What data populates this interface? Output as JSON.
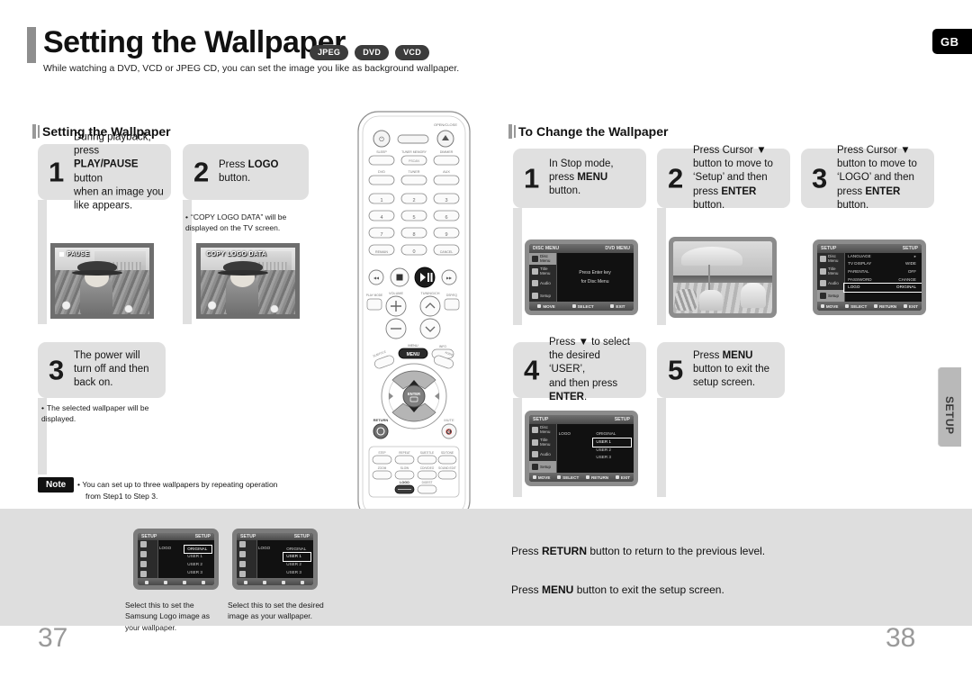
{
  "page": {
    "title": "Setting the Wallpaper",
    "subtitle": "While watching a DVD, VCD or JPEG CD, you can set the image you like as background wallpaper.",
    "badges": [
      "JPEG",
      "DVD",
      "VCD"
    ],
    "region_tab": "GB",
    "side_tab": "SETUP",
    "page_number_left": "37",
    "page_number_right": "38"
  },
  "left_section": {
    "heading": "Setting the Wallpaper",
    "steps": [
      {
        "number": "1",
        "line1": "During playback, press",
        "line2_bold": "PLAY/PAUSE",
        "line2_rest": " button",
        "line3": "when an image you",
        "line4": "like appears."
      },
      {
        "number": "2",
        "line1_pre": "Press ",
        "line1_bold": "LOGO",
        "line2": "button."
      },
      {
        "number": "3",
        "line1": "The power will",
        "line2": "turn off and then",
        "line3": "back on."
      }
    ],
    "note_under_step2": "“COPY LOGO DATA” will be displayed on the TV screen.",
    "note_under_step3": "The selected wallpaper will be displayed.",
    "photo1_osd": "PAUSE",
    "photo2_osd": "COPY LOGO DATA",
    "note_label": "Note",
    "note_body_line1": "You can set up to three wallpapers by repeating operation",
    "note_body_line2": "from Step1 to Step 3."
  },
  "right_section": {
    "heading": "To Change the Wallpaper",
    "steps": [
      {
        "number": "1",
        "line1": "In Stop mode,",
        "line2_pre": "press ",
        "line2_bold": "MENU",
        "line3": "button."
      },
      {
        "number": "2",
        "line1": "Press Cursor ▼",
        "line2": "button to move to",
        "line3": "‘Setup’ and then",
        "line4_pre": "press ",
        "line4_bold": "ENTER",
        "line4_post": " button."
      },
      {
        "number": "3",
        "line1": "Press Cursor ▼",
        "line2": "button to move to",
        "line3": "‘LOGO’ and then",
        "line4_pre": "press ",
        "line4_bold": "ENTER",
        "line4_post": " button."
      },
      {
        "number": "4",
        "line1": "Press ▼ to select",
        "line2": "the desired ‘USER’,",
        "line3": "and then press",
        "line4_bold": "ENTER",
        "line4_post": "."
      },
      {
        "number": "5",
        "line1_pre": "Press ",
        "line1_bold": "MENU",
        "line2": "button to exit the",
        "line3": "setup screen."
      }
    ]
  },
  "osd_screens": {
    "screen1": {
      "title_left": "DISC MENU",
      "title_right": "DVD MENU",
      "sidebar": [
        "Disc Menu",
        "Title Menu",
        "Audio",
        "Setup"
      ],
      "center_line1": "Press Enter key",
      "center_line2": "for Disc Menu",
      "footer": [
        "MOVE",
        "SELECT",
        "EXIT"
      ]
    },
    "screen2": {
      "title_left": "SETUP",
      "title_right": "SETUP",
      "sidebar": [
        "Disc Menu",
        "Title Menu",
        "Audio",
        "Setup"
      ],
      "rows": [
        {
          "label": "LANGUAGE",
          "value": ""
        },
        {
          "label": "TV DISPLAY",
          "value": "WIDE"
        },
        {
          "label": "PARENTAL",
          "value": "OFF"
        },
        {
          "label": "PASSWORD",
          "value": "CHANGE"
        },
        {
          "label": "LOGO",
          "value": "ORIGINAL",
          "highlighted": true
        }
      ],
      "footer": [
        "MOVE",
        "SELECT",
        "RETURN",
        "EXIT"
      ]
    },
    "screen3": {
      "title_left": "SETUP",
      "title_right": "SETUP",
      "sidebar": [
        "Disc Menu",
        "Title Menu",
        "Audio",
        "Setup"
      ],
      "field_label": "LOGO",
      "options": [
        "ORIGINAL",
        "USER 1",
        "USER 2",
        "USER 3"
      ],
      "selected_option": "USER 1",
      "footer": [
        "MOVE",
        "SELECT",
        "RETURN",
        "EXIT"
      ]
    },
    "screen_bottom_1": {
      "title_left": "SETUP",
      "title_right": "SETUP",
      "field_label": "LOGO",
      "options": [
        "ORIGINAL",
        "USER 1",
        "USER 2",
        "USER 3"
      ],
      "selected_option": "ORIGINAL"
    },
    "screen_bottom_2": {
      "title_left": "SETUP",
      "title_right": "SETUP",
      "field_label": "LOGO",
      "options": [
        "ORIGINAL",
        "USER 1",
        "USER 2",
        "USER 3"
      ],
      "selected_option": "USER 1"
    }
  },
  "bottom": {
    "caption1_line1": "Select this to set the",
    "caption1_line2": "Samsung Logo image as",
    "caption1_line3": "your wallpaper.",
    "caption2_line1": "Select this to set the desired",
    "caption2_line2": "image as your wallpaper.",
    "tip1_pre": "Press ",
    "tip1_bold": "RETURN",
    "tip1_post": " button to return to the previous level.",
    "tip2_pre": "Press ",
    "tip2_bold": "MENU",
    "tip2_post": " button to exit the setup screen."
  },
  "remote": {
    "labels": {
      "open_close": "OPEN/CLOSE",
      "sleep": "SLEEP",
      "tuner_memory": "TUNER MEMORY",
      "dimmer": "DIMMER",
      "dvd": "DVD",
      "tuner": "TUNER",
      "aux": "AUX",
      "remain": "REMAIN",
      "cancel": "CANCEL",
      "volume": "VOLUME",
      "tuning": "TUNING/CH",
      "play_mode": "PLAY MODE",
      "dsp_eq": "DSP/EQ",
      "menu": "MENU",
      "enter": "ENTER",
      "return": "RETURN",
      "mute": "MUTE",
      "logo": "LOGO",
      "step": "STEP",
      "repeat": "REPEAT",
      "subtitle": "SUBTITLE",
      "sd_tone": "SD/TONE",
      "zoom": "ZOOM",
      "slow": "SLOW",
      "cd_video": "CD/VIDEO",
      "sound_edit": "SOUND EDIT",
      "digest": "DIGEST",
      "p_scan": "P.SCAN",
      "test_tone": "TEST TONE",
      "numbers": [
        "1",
        "2",
        "3",
        "4",
        "5",
        "6",
        "7",
        "8",
        "9",
        "0"
      ]
    },
    "highlighted_buttons": [
      "PLAY/PAUSE",
      "MENU",
      "RETURN",
      "LOGO",
      "cursor-up",
      "cursor-down",
      "ENTER"
    ]
  }
}
